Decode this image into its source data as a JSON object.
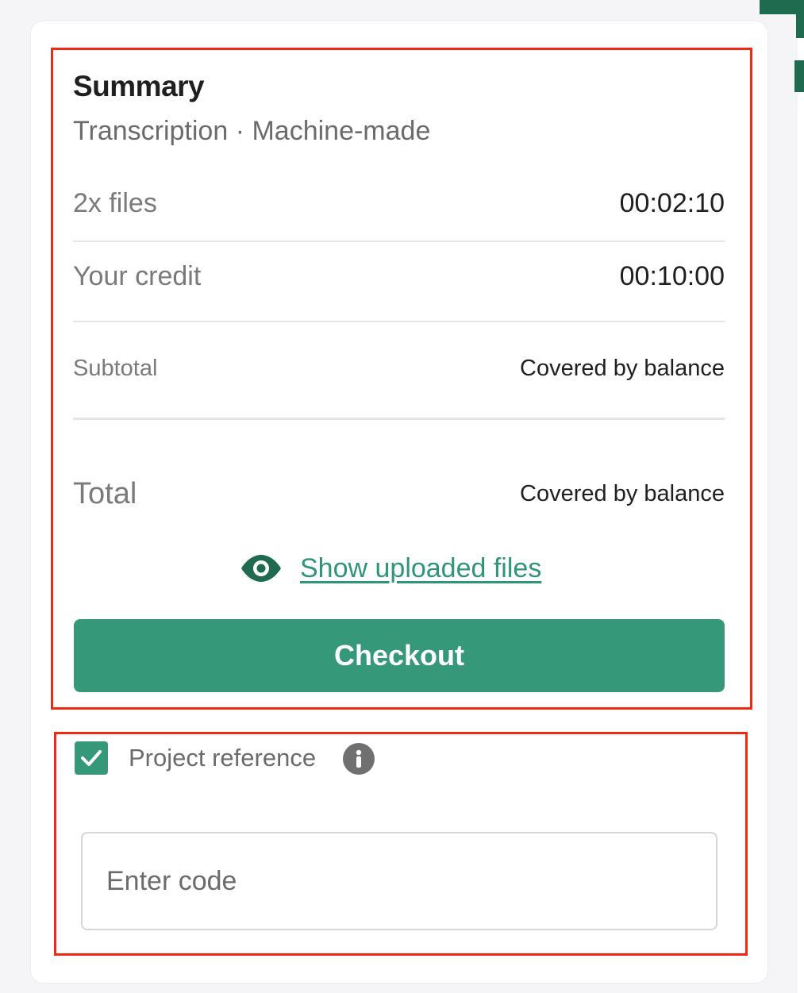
{
  "summary": {
    "title": "Summary",
    "subtitle": "Transcription · Machine-made",
    "files_label": "2x files",
    "files_value": "00:02:10",
    "credit_label": "Your credit",
    "credit_value": "00:10:00",
    "subtotal_label": "Subtotal",
    "subtotal_value": "Covered by balance",
    "total_label": "Total",
    "total_value": "Covered by balance",
    "show_files_label": "Show uploaded files",
    "checkout_label": "Checkout"
  },
  "project_reference": {
    "checkbox_checked": true,
    "label": "Project reference",
    "input_placeholder": "Enter code",
    "input_value": ""
  },
  "colors": {
    "accent": "#349879",
    "link": "#2f9577",
    "highlight_border": "#ee2a12"
  },
  "icons": {
    "show_files": "eye-icon",
    "checkbox": "checkmark-icon",
    "info": "info-icon"
  }
}
